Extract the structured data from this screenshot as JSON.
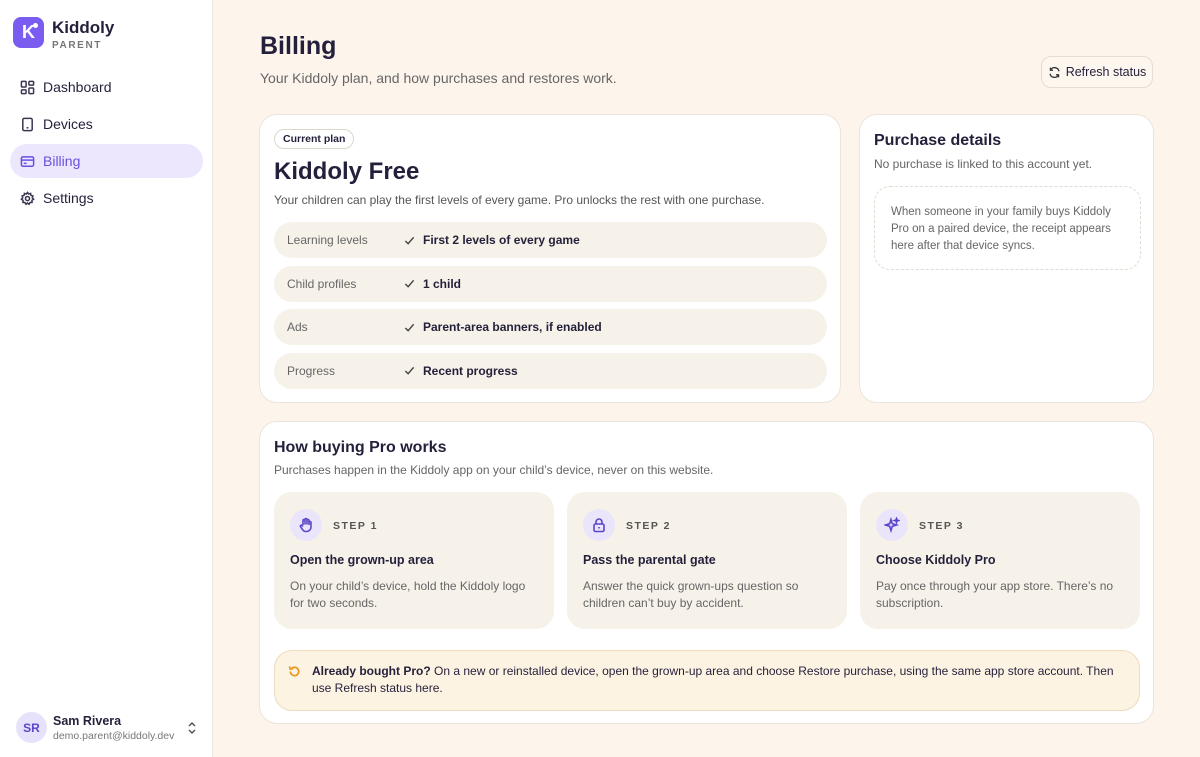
{
  "brand": {
    "logo_letter": "K",
    "name": "Kiddoly",
    "sub": "PARENT"
  },
  "nav": [
    {
      "label": "Dashboard",
      "icon": "dashboard-icon",
      "active": false
    },
    {
      "label": "Devices",
      "icon": "device-icon",
      "active": false
    },
    {
      "label": "Billing",
      "icon": "credit-card-icon",
      "active": true
    },
    {
      "label": "Settings",
      "icon": "gear-icon",
      "active": false
    }
  ],
  "user": {
    "initials": "SR",
    "name": "Sam Rivera",
    "email": "demo.parent@kiddoly.dev"
  },
  "header": {
    "title": "Billing",
    "subtitle": "Your Kiddoly plan, and how purchases and restores work.",
    "refresh_label": "Refresh status"
  },
  "plan": {
    "chip": "Current plan",
    "name": "Kiddoly Free",
    "description": "Your children can play the first levels of every game. Pro unlocks the rest with one purchase.",
    "features": [
      {
        "label": "Learning levels",
        "value": "First 2 levels of every game"
      },
      {
        "label": "Child profiles",
        "value": "1 child"
      },
      {
        "label": "Ads",
        "value": "Parent-area banners, if enabled"
      },
      {
        "label": "Progress",
        "value": "Recent progress"
      }
    ]
  },
  "purchase": {
    "title": "Purchase details",
    "subtitle": "No purchase is linked to this account yet.",
    "empty_text": "When someone in your family buys Kiddoly Pro on a paired device, the receipt appears here after that device syncs."
  },
  "how": {
    "title": "How buying Pro works",
    "subtitle": "Purchases happen in the Kiddoly app on your child’s device, never on this website.",
    "steps": [
      {
        "icon": "hand-icon",
        "num": "STEP 1",
        "title": "Open the grown-up area",
        "desc": "On your child’s device, hold the Kiddoly logo for two seconds."
      },
      {
        "icon": "lock-icon",
        "num": "STEP 2",
        "title": "Pass the parental gate",
        "desc": "Answer the quick grown-ups question so children can’t buy by accident."
      },
      {
        "icon": "sparkles-icon",
        "num": "STEP 3",
        "title": "Choose Kiddoly Pro",
        "desc": "Pay once through your app store. There’s no subscription."
      }
    ],
    "notice_bold": "Already bought Pro?",
    "notice_text": " On a new or reinstalled device, open the grown-up area and choose Restore purchase, using the same app store account. Then use Refresh status here."
  },
  "colors": {
    "accent": "#7b5cf0",
    "background": "#fdf5ec",
    "notice": "#e8951c"
  }
}
